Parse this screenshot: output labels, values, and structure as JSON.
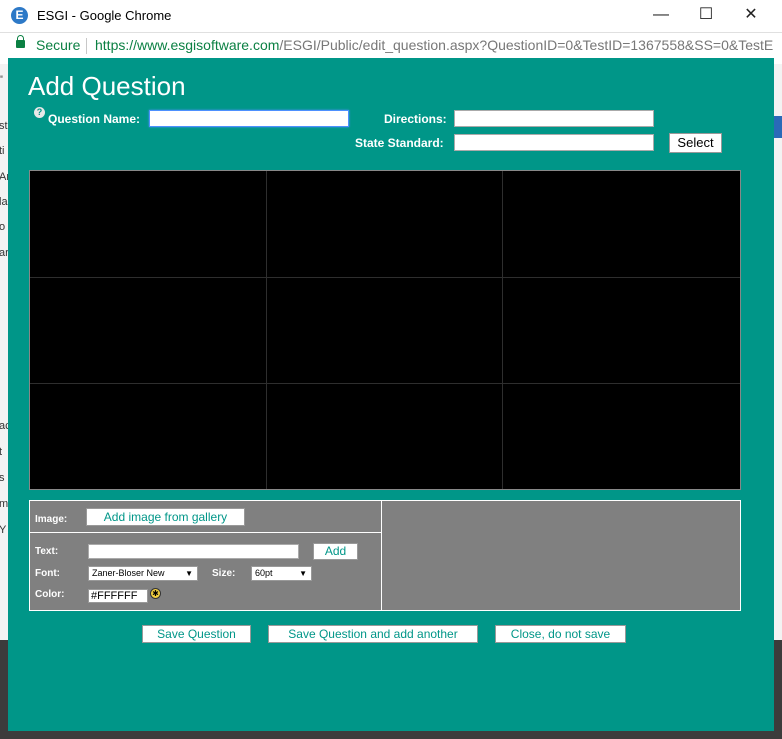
{
  "window": {
    "title": "ESGI - Google Chrome",
    "app_icon_glyph": "E",
    "minimize_glyph": "—",
    "maximize_glyph": "☐",
    "close_glyph": "✕"
  },
  "address_bar": {
    "security_label": "Secure",
    "url_origin": "https://www.esgisoftware.com",
    "url_path": "/ESGI/Public/edit_question.aspx?QuestionID=0&TestID=1367558&SS=0&TestE"
  },
  "dialog": {
    "title": "Add Question",
    "help_glyph": "?",
    "question_name_label": "Question Name:",
    "question_name_value": "",
    "directions_label": "Directions:",
    "directions_value": "",
    "state_standard_label": "State Standard:",
    "state_standard_value": "",
    "select_button": "Select"
  },
  "tools": {
    "image_label": "Image:",
    "add_image_button": "Add image from gallery",
    "text_label": "Text:",
    "text_value": "",
    "add_button": "Add",
    "font_label": "Font:",
    "font_value": "Zaner-Bloser New",
    "size_label": "Size:",
    "size_value": "60pt",
    "color_label": "Color:",
    "color_value": "#FFFFFF",
    "dropdown_glyph": "▼"
  },
  "actions": {
    "save": "Save Question",
    "save_and_add": "Save Question and add another",
    "close": "Close, do not save"
  },
  "colors": {
    "dialog_bg": "#009688",
    "canvas_bg": "#000000",
    "panel_bg": "#808080",
    "secure_green": "#0b8043"
  },
  "background_page": {
    "left_fragments": [
      "\"",
      "st",
      "ti",
      "Ar",
      "la",
      "o",
      "ar",
      "ac",
      "t",
      "s",
      "m",
      "Y"
    ]
  }
}
